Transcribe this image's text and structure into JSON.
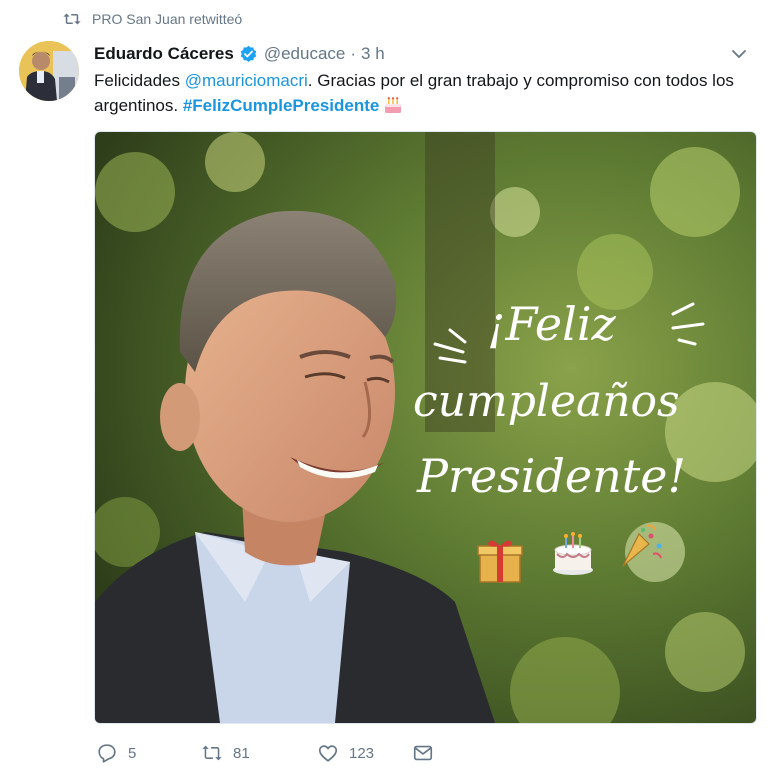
{
  "retweet_context": {
    "text": "PRO San Juan retwitteó"
  },
  "tweet": {
    "author_name": "Eduardo Cáceres",
    "handle": "@educace",
    "separator": "·",
    "time": "3 h",
    "text_before_mention": "Felicidades ",
    "mention": "@mauriciomacri",
    "text_after_mention": ". Gracias por el gran trabajo y compromiso con todos los argentinos. ",
    "hashtag": "#FelizCumplePresidente"
  },
  "media": {
    "greeting_line1": "¡Feliz",
    "greeting_line2": "cumpleaños",
    "greeting_line3": "Presidente!"
  },
  "actions": {
    "replies": "5",
    "retweets": "81",
    "likes": "123"
  },
  "colors": {
    "link": "#1b95e0",
    "muted": "#657786",
    "verified": "#1da1f2"
  },
  "icons": [
    "retweet-icon",
    "verified-badge-icon",
    "caret-down-icon",
    "birthday-cake-emoji",
    "reply-icon",
    "like-icon",
    "direct-message-icon",
    "gift-icon",
    "party-popper-icon"
  ]
}
